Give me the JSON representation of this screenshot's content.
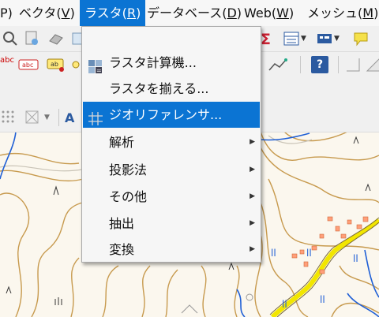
{
  "menubar": {
    "items": [
      {
        "label": "P)"
      },
      {
        "label": "ベクタ(V)",
        "text": "ベクタ(",
        "key": "V",
        "tail": ")"
      },
      {
        "label": "ラスタ(R)",
        "text": "ラスタ(",
        "key": "R",
        "tail": ")"
      },
      {
        "label": "データベース(D)",
        "text": "データベース(",
        "key": "D",
        "tail": ")"
      },
      {
        "label": "Web(W)",
        "text": "Web(",
        "key": "W",
        "tail": ")"
      },
      {
        "label": "メッシュ(M)",
        "text": "メッシュ(",
        "key": "M",
        "tail": ")"
      }
    ]
  },
  "raster_menu": {
    "items": [
      {
        "label": "ラスタ計算機...",
        "icon": "raster-calculator-icon",
        "submenu": false
      },
      {
        "label": "ラスタを揃える...",
        "icon": "",
        "submenu": false
      },
      {
        "label": "ジオリファレンサ...",
        "icon": "georeferencer-icon",
        "submenu": false,
        "highlighted": true
      },
      {
        "label": "解析",
        "icon": "",
        "submenu": true
      },
      {
        "label": "投影法",
        "icon": "",
        "submenu": true
      },
      {
        "label": "その他",
        "icon": "",
        "submenu": true
      },
      {
        "label": "抽出",
        "icon": "",
        "submenu": true
      },
      {
        "label": "変換",
        "icon": "",
        "submenu": true
      }
    ],
    "submenu_arrow": "▶"
  },
  "toolbar": {
    "abc_label": "abc",
    "ab_label": "ab",
    "text_tool": "A",
    "help_label": "?",
    "sigma": "Σ"
  },
  "colors": {
    "accent": "#0b74d3",
    "contour": "#c79a4e",
    "road": "#f2e600",
    "water": "#1f5fd6"
  }
}
